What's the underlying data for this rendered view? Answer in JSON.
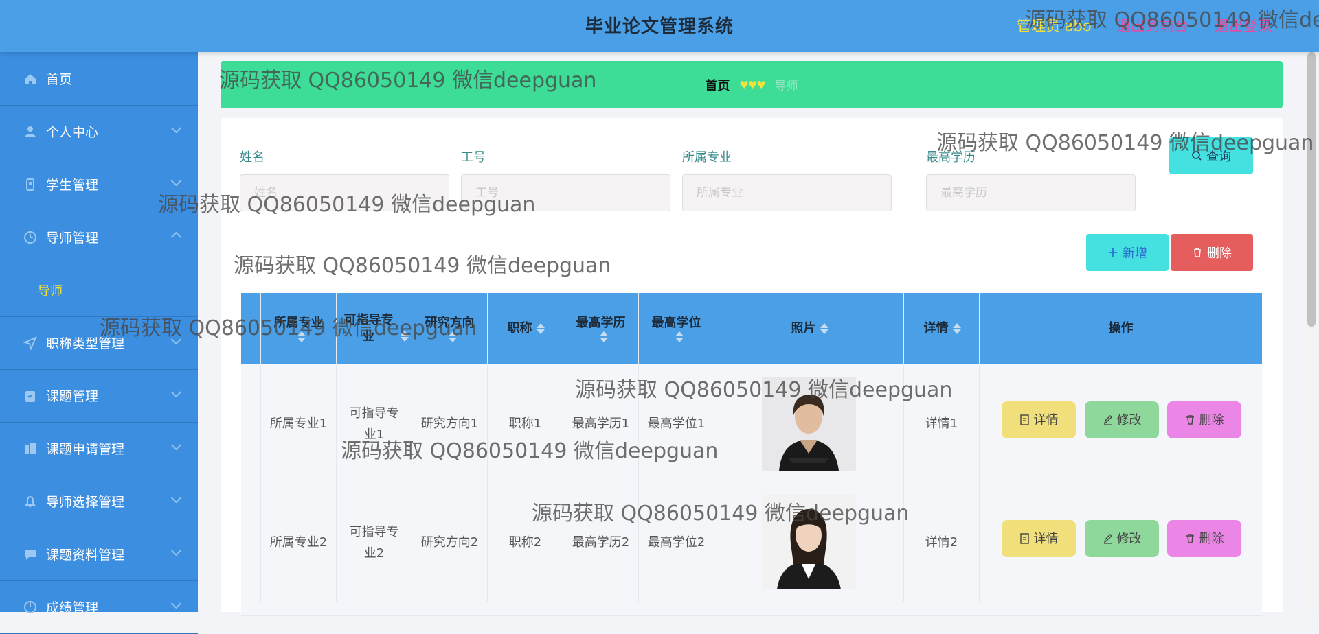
{
  "header": {
    "title": "毕业论文管理系统",
    "admin_text": "管理员 abo",
    "front_link": "退出到前台",
    "logout_link": "退出登录"
  },
  "sidebar": {
    "items": [
      {
        "label": "首页",
        "icon": "home-icon"
      },
      {
        "label": "个人中心",
        "icon": "user-icon"
      },
      {
        "label": "学生管理",
        "icon": "student-icon"
      },
      {
        "label": "导师管理",
        "icon": "clock-icon",
        "expanded": true
      },
      {
        "label": "职称类型管理",
        "icon": "send-icon"
      },
      {
        "label": "课题管理",
        "icon": "clipboard-icon"
      },
      {
        "label": "课题申请管理",
        "icon": "building-icon"
      },
      {
        "label": "导师选择管理",
        "icon": "bell-icon"
      },
      {
        "label": "课题资料管理",
        "icon": "chat-icon"
      },
      {
        "label": "成绩管理",
        "icon": "chart-icon"
      }
    ],
    "sub_item": "导师"
  },
  "breadcrumb": {
    "home": "首页",
    "separator": "♥♥♥",
    "current": "导师"
  },
  "search": {
    "name_label": "姓名",
    "name_placeholder": "姓名",
    "id_label": "工号",
    "id_placeholder": "工号",
    "major_label": "所属专业",
    "major_placeholder": "所属专业",
    "degree_label": "最高学历",
    "degree_placeholder": "最高学历",
    "query_label": "查询"
  },
  "toolbar": {
    "add_label": "新增",
    "delete_label": "删除"
  },
  "table": {
    "columns": [
      "所属专业",
      "可指导专业",
      "研究方向",
      "职称",
      "最高学历",
      "最高学位",
      "照片",
      "详情",
      "操作"
    ],
    "rows": [
      {
        "major": "所属专业1",
        "guide": "可指导专业1",
        "research": "研究方向1",
        "title": "职称1",
        "edu": "最高学历1",
        "degree": "最高学位1",
        "detail": "详情1"
      },
      {
        "major": "所属专业2",
        "guide": "可指导专业2",
        "research": "研究方向2",
        "title": "职称2",
        "edu": "最高学历2",
        "degree": "最高学位2",
        "detail": "详情2"
      }
    ],
    "actions": {
      "detail": "详情",
      "edit": "修改",
      "delete": "删除"
    }
  },
  "watermark": "源码获取 QQ86050149 微信deepguan",
  "colors": {
    "topbar": "#4a9fe6",
    "sidebar": "#3b8ee0",
    "breadcrumb": "#3ddc97",
    "accent_yellow": "#f3e23a",
    "link_pink": "#e64da0",
    "cyan_button": "#45e0e0",
    "red_button": "#e55d5d"
  }
}
